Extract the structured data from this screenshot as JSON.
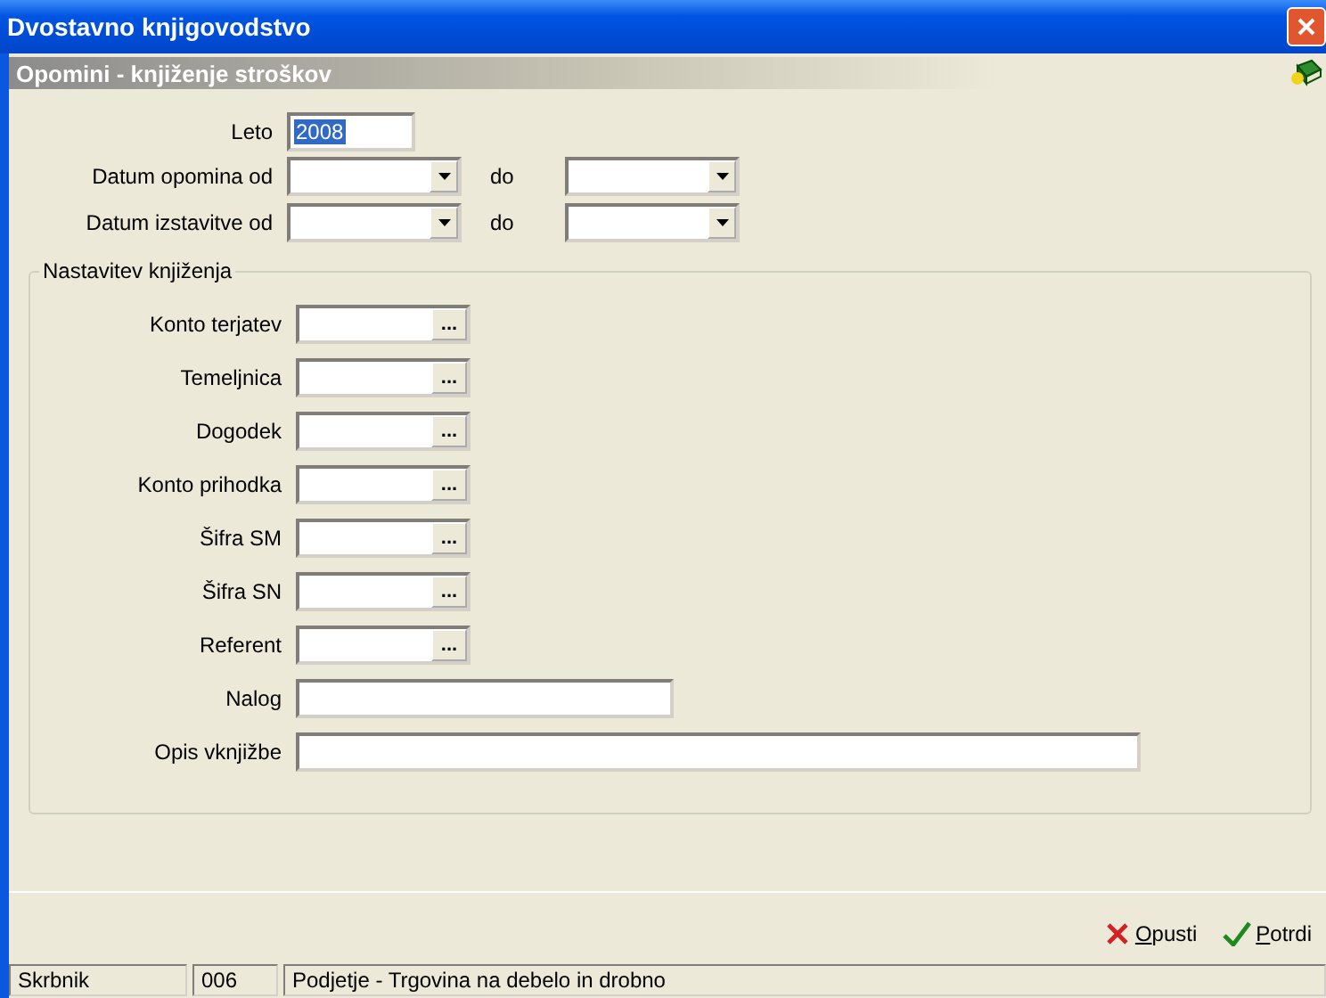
{
  "window": {
    "title": "Dvostavno knjigovodstvo"
  },
  "form": {
    "title": "Opomini - knjiženje stroškov",
    "year": {
      "label": "Leto",
      "value": "2008",
      "value_selected": true
    },
    "date_ranges": [
      {
        "label": "Datum opomina od",
        "to_label": "do"
      },
      {
        "label": "Datum izstavitve od",
        "to_label": "do"
      }
    ],
    "group": {
      "title": "Nastavitev knjiženja",
      "fields": [
        {
          "label": "Konto terjatev",
          "kind": "lookup",
          "button": "..."
        },
        {
          "label": "Temeljnica",
          "kind": "lookup",
          "button": "..."
        },
        {
          "label": "Dogodek",
          "kind": "lookup",
          "button": "..."
        },
        {
          "label": "Konto prihodka",
          "kind": "lookup",
          "button": "..."
        },
        {
          "label": "Šifra SM",
          "kind": "lookup",
          "button": "..."
        },
        {
          "label": "Šifra SN",
          "kind": "lookup",
          "button": "..."
        },
        {
          "label": "Referent",
          "kind": "lookup",
          "button": "..."
        },
        {
          "label": "Nalog",
          "kind": "short"
        },
        {
          "label": "Opis vknjižbe",
          "kind": "long"
        }
      ]
    }
  },
  "buttons": [
    {
      "label": "Opusti",
      "kind": "cancel"
    },
    {
      "label": "Potrdi",
      "kind": "confirm"
    }
  ],
  "status_bar": [
    "Skrbnik",
    "006",
    "Podjetje - Trgovina na debelo in drobno"
  ]
}
